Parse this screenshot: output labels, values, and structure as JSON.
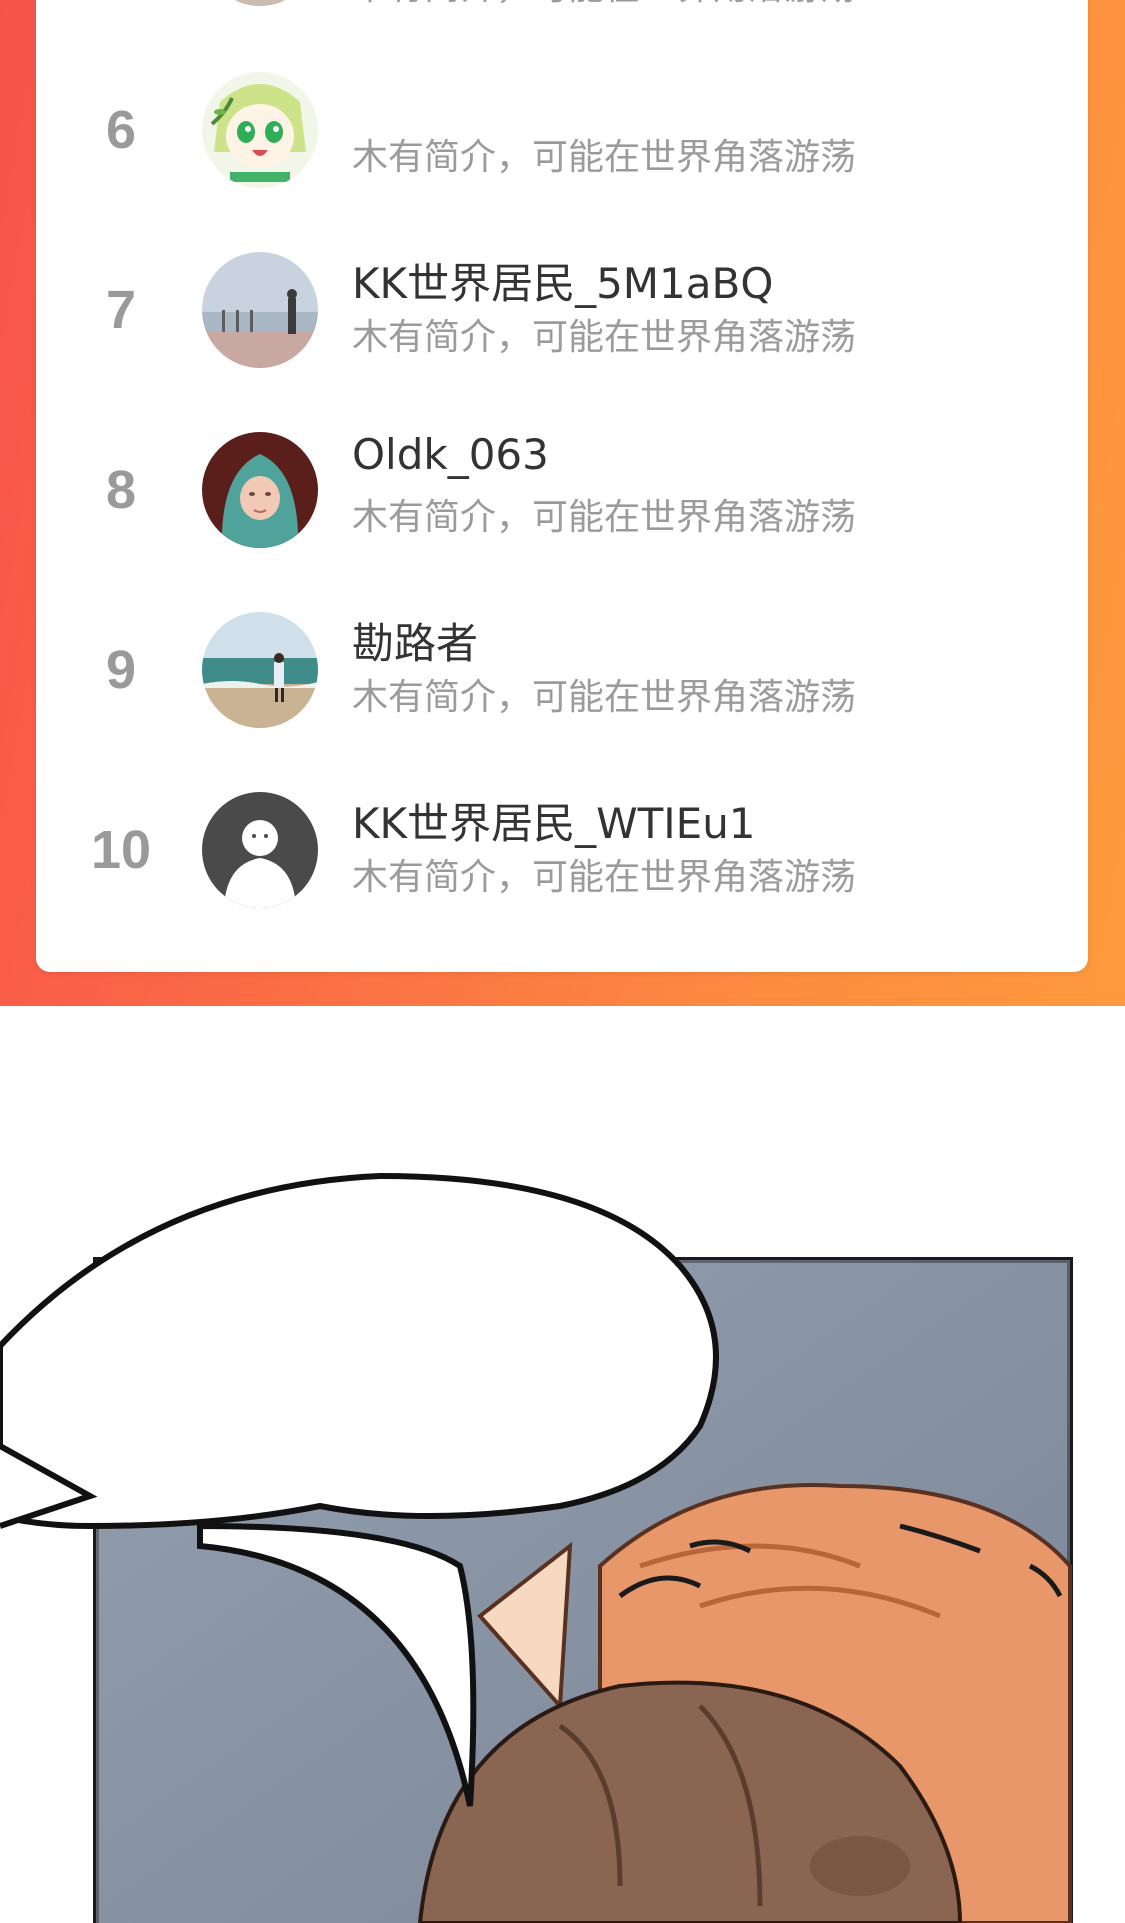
{
  "ranking": {
    "rows": [
      {
        "rank": "",
        "name": "",
        "bio": "木有简介，可能在世界角落游荡"
      },
      {
        "rank": "6",
        "name": "",
        "bio": "木有简介，可能在世界角落游荡"
      },
      {
        "rank": "7",
        "name": "KK世界居民_5M1aBQ",
        "bio": "木有简介，可能在世界角落游荡"
      },
      {
        "rank": "8",
        "name": "Oldk_063",
        "bio": "木有简介，可能在世界角落游荡"
      },
      {
        "rank": "9",
        "name": "勘路者",
        "bio": "木有简介，可能在世界角落游荡"
      },
      {
        "rank": "10",
        "name": "KK世界居民_WTIEu1",
        "bio": "木有简介，可能在世界角落游荡"
      }
    ]
  },
  "colors": {
    "gradient_start": "#f8534a",
    "gradient_end": "#fe9a3d",
    "rank_number": "#9a9a9a",
    "name_text": "#333333",
    "bio_text": "#9b9b9b"
  },
  "icons": {
    "avatar_6": "anime-girl-avatar-icon",
    "avatar_7": "seaside-person-avatar-icon",
    "avatar_8": "child-hood-avatar-icon",
    "avatar_9": "beach-walker-avatar-icon",
    "avatar_10": "default-user-avatar-icon"
  }
}
